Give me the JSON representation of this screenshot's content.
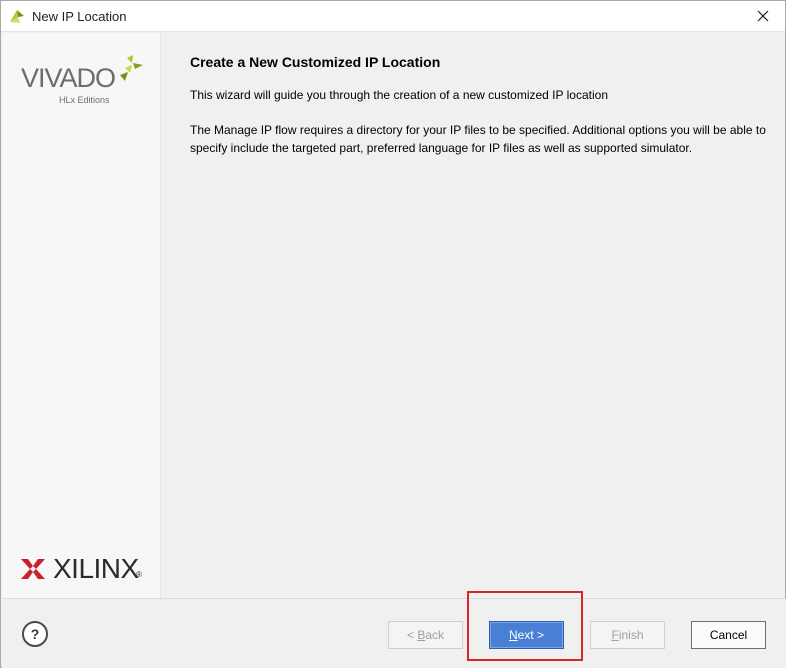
{
  "window": {
    "title": "New IP Location",
    "icon": "vivado-leaf-icon",
    "close_icon": "close-icon"
  },
  "sidebar": {
    "top_logo": {
      "word": "VIVADO",
      "subtitle": "HLx Editions"
    },
    "bottom_logo": {
      "word": "XILINX",
      "registered": "®"
    }
  },
  "main": {
    "heading": "Create a New Customized IP Location",
    "intro": "This wizard will guide you through the creation of a new customized IP location",
    "description": "The Manage IP flow requires a directory for your IP files to be specified. Additional options you will be able to specify include the targeted part, preferred language for IP files as well as supported simulator."
  },
  "footer": {
    "help_label": "?",
    "back": {
      "prefix": "< ",
      "mnemonic": "B",
      "rest": "ack",
      "enabled": false
    },
    "next": {
      "mnemonic": "N",
      "rest": "ext >",
      "enabled": true
    },
    "finish": {
      "mnemonic": "F",
      "rest": "inish",
      "enabled": false
    },
    "cancel": {
      "label": "Cancel",
      "enabled": true
    }
  },
  "colors": {
    "accent_button": "#4a7fd6",
    "highlight_box": "#d62828",
    "vivado_green": "#a6b82e",
    "xilinx_red": "#c8202f"
  }
}
